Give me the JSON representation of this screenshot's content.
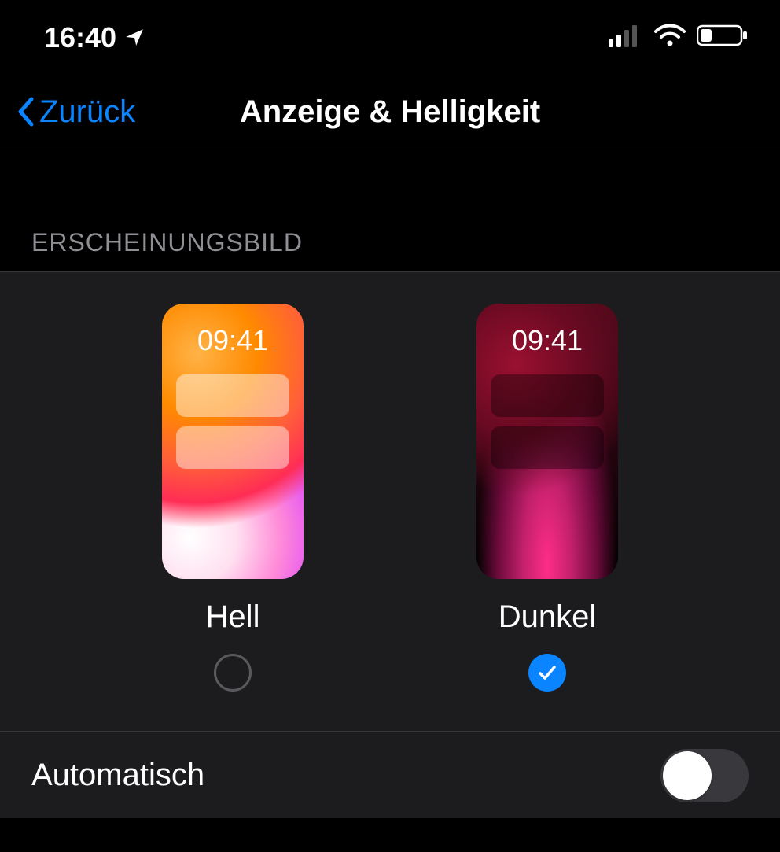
{
  "status": {
    "time": "16:40"
  },
  "nav": {
    "back": "Zurück",
    "title": "Anzeige & Helligkeit"
  },
  "appearance": {
    "header": "ERSCHEINUNGSBILD",
    "options": {
      "light": {
        "label": "Hell",
        "preview_time": "09:41",
        "selected": false
      },
      "dark": {
        "label": "Dunkel",
        "preview_time": "09:41",
        "selected": true
      }
    }
  },
  "automatic": {
    "label": "Automatisch",
    "enabled": false
  },
  "colors": {
    "accent": "#0a84ff"
  }
}
